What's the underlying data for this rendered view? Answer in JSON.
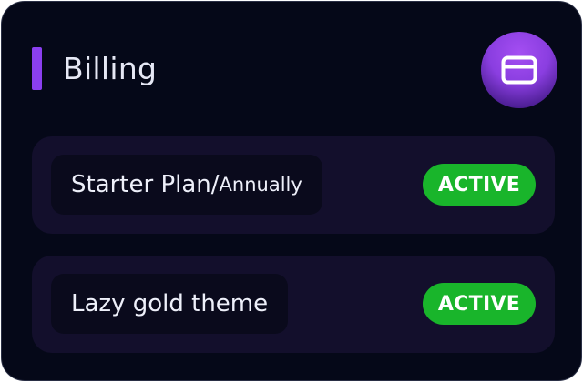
{
  "header": {
    "title": "Billing",
    "icon": "credit-card-icon"
  },
  "items": [
    {
      "name": "Starter Plan/",
      "period": "Annually",
      "status": "ACTIVE"
    },
    {
      "name": "Lazy gold theme",
      "status": "ACTIVE"
    }
  ],
  "colors": {
    "card_bg": "#050818",
    "accent": "#8b3ff0",
    "row_bg": "#130f2c",
    "pill_bg": "#0a0a1c",
    "status_active": "#19b52b"
  }
}
